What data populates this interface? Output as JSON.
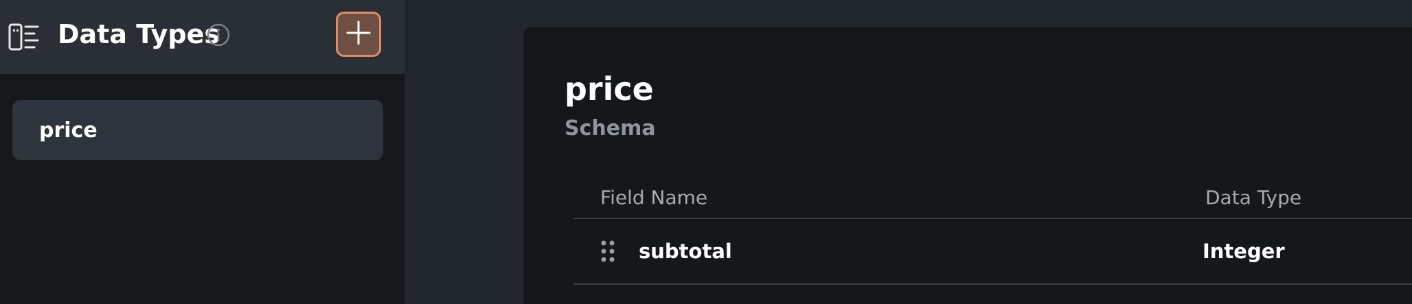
{
  "sidebar": {
    "title": "Data Types",
    "header_icon": "data-types-icon",
    "info_icon": "info-icon",
    "add_icon": "plus-icon",
    "items": [
      {
        "label": "price",
        "selected": true
      }
    ]
  },
  "main": {
    "title": "price",
    "section_label": "Schema",
    "table": {
      "columns": [
        "Field Name",
        "Data Type"
      ],
      "rows": [
        {
          "field_name": "subtotal",
          "data_type": "Integer",
          "icon": "drag-handle-icon"
        }
      ]
    }
  },
  "colors": {
    "background": "#22272d",
    "sidebar_bg": "#16191c",
    "sidebar_header_bg": "#2a2f36",
    "selected_item_bg": "#2e343c",
    "panel_bg": "#15181b",
    "accent": "#e08d6a",
    "accent_fill": "#6e5042",
    "muted_text": "#8e959c"
  }
}
